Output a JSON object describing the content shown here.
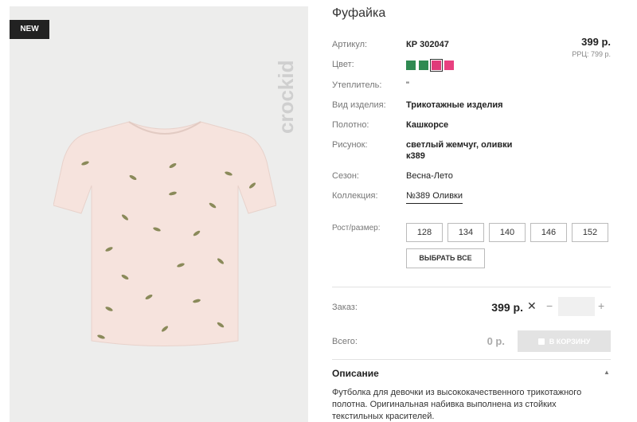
{
  "badge": "NEW",
  "brand": "crockid",
  "title": "Фуфайка",
  "price": {
    "value": "399 р.",
    "rrp": "РРЦ: 799 р."
  },
  "attributes": [
    {
      "label": "Артикул:",
      "value": "КР 302047"
    },
    {
      "label": "Цвет:",
      "value": ""
    },
    {
      "label": "Утеплитель:",
      "value": "\""
    },
    {
      "label": "Вид изделия:",
      "value": "Трикотажные изделия"
    },
    {
      "label": "Полотно:",
      "value": "Кашкорсе"
    },
    {
      "label": "Рисунок:",
      "value": "светлый жемчуг, оливки",
      "value2": "к389"
    },
    {
      "label": "Сезон:",
      "value": "Весна-Лето"
    },
    {
      "label": "Коллекция:",
      "value": "№389 Оливки"
    }
  ],
  "colors": [
    "#2f8a52",
    "#2f8a52",
    "#e03a7a",
    "#e8407f"
  ],
  "sizes": {
    "label": "Рост/размер:",
    "options": [
      "128",
      "134",
      "140",
      "146",
      "152"
    ],
    "select_all": "ВЫБРАТЬ ВСЕ"
  },
  "order": {
    "label": "Заказ:",
    "price": "399 р.",
    "times": "✕",
    "minus": "−",
    "plus": "+",
    "quantity": ""
  },
  "total": {
    "label": "Всего:",
    "value": "0 р.",
    "cart_button": "В КОРЗИНУ"
  },
  "description": {
    "title": "Описание",
    "text": "Футболка для девочки из высококачественного трикотажного полотна. Оригинальная набивка выполнена из стойких текстильных красителей."
  }
}
